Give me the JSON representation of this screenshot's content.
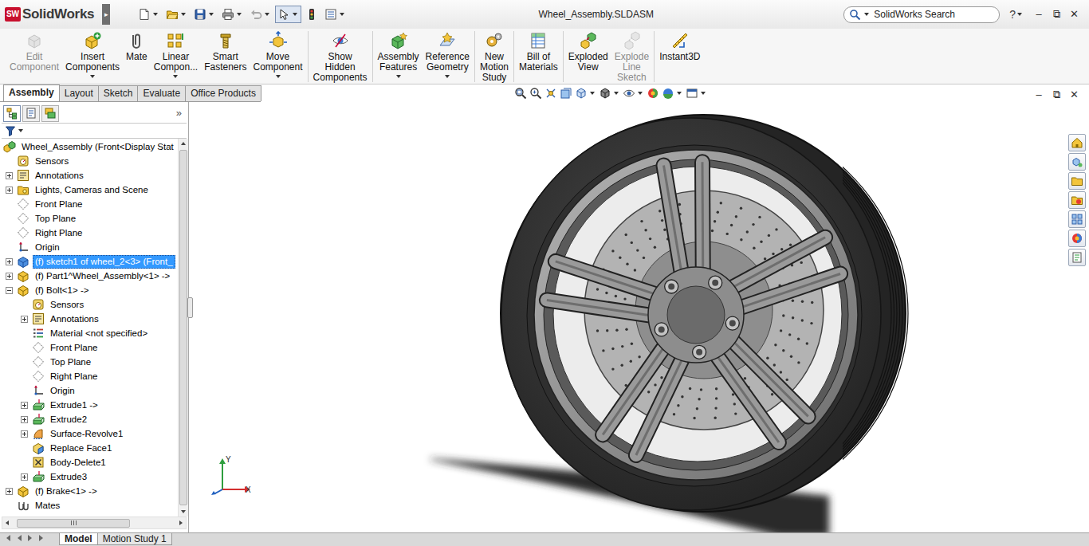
{
  "app": {
    "logo_badge": "SW",
    "logo_text": "SolidWorks",
    "menu_arrow": "▸"
  },
  "window": {
    "title": "Wheel_Assembly.SLDASM",
    "controls": [
      "–",
      "⧉",
      "✕"
    ]
  },
  "search": {
    "placeholder": "SolidWorks Search"
  },
  "help": {
    "label": "?"
  },
  "ribbon": [
    {
      "buttons": [
        {
          "lines": [
            "Edit",
            "Component"
          ],
          "kind": "edit",
          "disabled": true,
          "menu": false
        },
        {
          "lines": [
            "Insert",
            "Components"
          ],
          "kind": "insert",
          "disabled": false,
          "menu": true
        },
        {
          "lines": [
            "Mate"
          ],
          "kind": "mate",
          "disabled": false,
          "menu": false
        },
        {
          "lines": [
            "Linear",
            "Compon..."
          ],
          "kind": "linear",
          "disabled": false,
          "menu": true
        },
        {
          "lines": [
            "Smart",
            "Fasteners"
          ],
          "kind": "fastener",
          "disabled": false,
          "menu": false
        },
        {
          "lines": [
            "Move",
            "Component"
          ],
          "kind": "move",
          "disabled": false,
          "menu": true
        }
      ]
    },
    {
      "buttons": [
        {
          "lines": [
            "Show",
            "Hidden",
            "Components"
          ],
          "kind": "show",
          "disabled": false,
          "menu": false
        }
      ]
    },
    {
      "buttons": [
        {
          "lines": [
            "Assembly",
            "Features"
          ],
          "kind": "features",
          "disabled": false,
          "menu": true
        },
        {
          "lines": [
            "Reference",
            "Geometry"
          ],
          "kind": "refgeom",
          "disabled": false,
          "menu": true
        }
      ]
    },
    {
      "buttons": [
        {
          "lines": [
            "New",
            "Motion",
            "Study"
          ],
          "kind": "motion",
          "disabled": false,
          "menu": false
        }
      ]
    },
    {
      "buttons": [
        {
          "lines": [
            "Bill of",
            "Materials"
          ],
          "kind": "bom",
          "disabled": false,
          "menu": false
        }
      ]
    },
    {
      "buttons": [
        {
          "lines": [
            "Exploded",
            "View"
          ],
          "kind": "exploded",
          "disabled": false,
          "menu": false
        },
        {
          "lines": [
            "Explode",
            "Line",
            "Sketch"
          ],
          "kind": "explodeline",
          "disabled": true,
          "menu": false
        }
      ]
    },
    {
      "buttons": [
        {
          "lines": [
            "Instant3D"
          ],
          "kind": "instant3d",
          "disabled": false,
          "menu": false
        }
      ]
    }
  ],
  "command_tabs": [
    {
      "label": "Assembly",
      "selected": true
    },
    {
      "label": "Layout",
      "selected": false
    },
    {
      "label": "Sketch",
      "selected": false
    },
    {
      "label": "Evaluate",
      "selected": false
    },
    {
      "label": "Office Products",
      "selected": false
    }
  ],
  "panel": {
    "expand": "»",
    "tabs": [
      {
        "kind": "feature",
        "selected": true
      },
      {
        "kind": "property",
        "selected": false
      },
      {
        "kind": "config",
        "selected": false
      }
    ]
  },
  "tree": {
    "label": "Wheel_Assembly  (Front<Display Stat",
    "kind": "assembly",
    "children": [
      {
        "label": "Sensors",
        "kind": "sensor",
        "expandable": false,
        "expanded": false,
        "selected": false
      },
      {
        "label": "Annotations",
        "kind": "annotation",
        "expandable": true,
        "expanded": false,
        "selected": false
      },
      {
        "label": "Lights, Cameras and Scene",
        "kind": "lights",
        "expandable": true,
        "expanded": false,
        "selected": false
      },
      {
        "label": "Front Plane",
        "kind": "plane",
        "expandable": false,
        "expanded": false,
        "selected": false
      },
      {
        "label": "Top Plane",
        "kind": "plane",
        "expandable": false,
        "expanded": false,
        "selected": false
      },
      {
        "label": "Right Plane",
        "kind": "plane",
        "expandable": false,
        "expanded": false,
        "selected": false
      },
      {
        "label": "Origin",
        "kind": "origin",
        "expandable": false,
        "expanded": false,
        "selected": false
      },
      {
        "label": "(f) sketch1 of wheel_2<3> (Front_",
        "kind": "sketchpart",
        "expandable": true,
        "expanded": false,
        "selected": true
      },
      {
        "label": "(f) Part1^Wheel_Assembly<1> ->",
        "kind": "part",
        "expandable": true,
        "expanded": false,
        "selected": false
      },
      {
        "label": "(f) Bolt<1> ->",
        "kind": "part",
        "expandable": true,
        "expanded": true,
        "selected": false,
        "children": [
          {
            "label": "Sensors",
            "kind": "sensor",
            "expandable": false,
            "expanded": false,
            "selected": false
          },
          {
            "label": "Annotations",
            "kind": "annotation",
            "expandable": true,
            "expanded": false,
            "selected": false
          },
          {
            "label": "Material <not specified>",
            "kind": "material",
            "expandable": false,
            "expanded": false,
            "selected": false
          },
          {
            "label": "Front Plane",
            "kind": "plane",
            "expandable": false,
            "expanded": false,
            "selected": false
          },
          {
            "label": "Top Plane",
            "kind": "plane",
            "expandable": false,
            "expanded": false,
            "selected": false
          },
          {
            "label": "Right Plane",
            "kind": "plane",
            "expandable": false,
            "expanded": false,
            "selected": false
          },
          {
            "label": "Origin",
            "kind": "origin",
            "expandable": false,
            "expanded": false,
            "selected": false
          },
          {
            "label": "Extrude1 ->",
            "kind": "extrude",
            "expandable": true,
            "expanded": false,
            "selected": false
          },
          {
            "label": "Extrude2",
            "kind": "extrude",
            "expandable": true,
            "expanded": false,
            "selected": false
          },
          {
            "label": "Surface-Revolve1",
            "kind": "revolve",
            "expandable": true,
            "expanded": false,
            "selected": false
          },
          {
            "label": "Replace Face1",
            "kind": "replace",
            "expandable": false,
            "expanded": false,
            "selected": false
          },
          {
            "label": "Body-Delete1",
            "kind": "delete",
            "expandable": false,
            "expanded": false,
            "selected": false
          },
          {
            "label": "Extrude3",
            "kind": "extrude",
            "expandable": true,
            "expanded": false,
            "selected": false
          }
        ]
      },
      {
        "label": "(f) Brake<1> ->",
        "kind": "part",
        "expandable": true,
        "expanded": false,
        "selected": false
      },
      {
        "label": "Mates",
        "kind": "mates",
        "expandable": false,
        "expanded": false,
        "selected": false
      }
    ]
  },
  "viewport": {
    "controls": [
      "–",
      "⧉",
      "✕"
    ],
    "triad": {
      "y": "Y",
      "x": "X"
    }
  },
  "bottom_tabs": [
    {
      "label": "Model",
      "selected": true
    },
    {
      "label": "Motion Study 1",
      "selected": false
    }
  ]
}
